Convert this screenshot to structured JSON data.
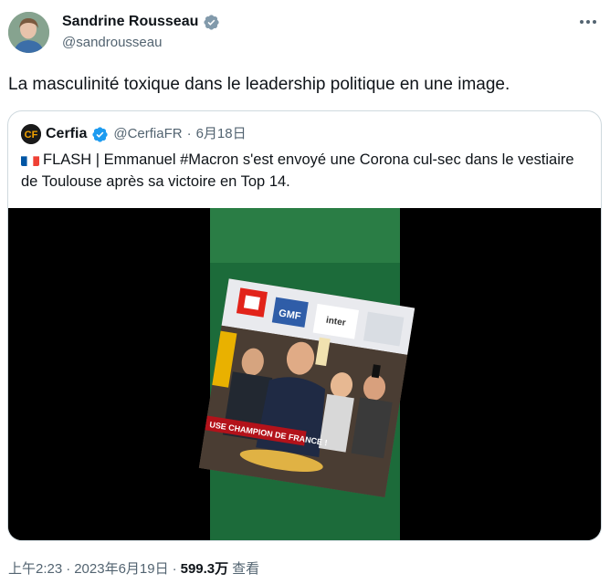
{
  "author": {
    "name": "Sandrine Rousseau",
    "handle": "@sandrousseau",
    "verified_icon": "verified-badge-icon",
    "avatar": "avatar"
  },
  "more_icon": "more-options-icon",
  "tweet": {
    "text": "La masculinité toxique dans le leadership politique en une image."
  },
  "quote": {
    "logo_text": "CF",
    "name": "Cerfia",
    "handle": "@CerfiaFR",
    "dot": "·",
    "date": "6月18日",
    "flag_icon": "france-flag-icon",
    "text": "FLASH | Emmanuel #Macron s'est envoyé une Corona cul-sec dans le vestiaire de Toulouse après sa victoire en Top 14.",
    "media": {
      "sign_gmf": "GMF",
      "sign_inter": "inter",
      "caption": "USE CHAMPION DE FRANCE !"
    }
  },
  "footer": {
    "time": "上午2:23",
    "sep": "·",
    "date": "2023年6月19日",
    "views_count": "599.3万",
    "views_label": "查看"
  },
  "colors": {
    "verified": "#829aab",
    "muted_text": "#536471",
    "border": "#cfd9de",
    "quote_verified": "#1d9bf0",
    "cerfia_logo": "#f4a300"
  }
}
